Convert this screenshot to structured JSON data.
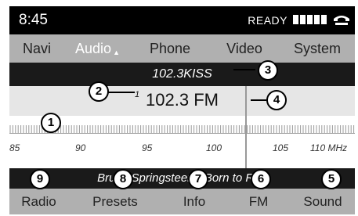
{
  "status": {
    "time": "8:45",
    "ready": "READY",
    "signal_bars": 5,
    "phone_icon": "phone-handset-icon"
  },
  "menu": {
    "items": [
      "Navi",
      "Audio",
      "Phone",
      "Video",
      "System"
    ],
    "active": "Audio",
    "active_marker": "▲"
  },
  "station": {
    "name": "102.3KISS"
  },
  "tuner": {
    "preset_number": "1",
    "frequency_display": "102.3 FM",
    "frequency_mhz": 102.3,
    "scale_labels": [
      "85",
      "90",
      "95",
      "100",
      "105",
      "110 MHz"
    ]
  },
  "now_playing": {
    "text": "Bruce Springsteen - Born to Run"
  },
  "bottom": {
    "items": [
      "Radio",
      "Presets",
      "Info",
      "FM",
      "Sound"
    ]
  },
  "callouts": [
    "1",
    "2",
    "3",
    "4",
    "5",
    "6",
    "7",
    "8",
    "9"
  ]
}
